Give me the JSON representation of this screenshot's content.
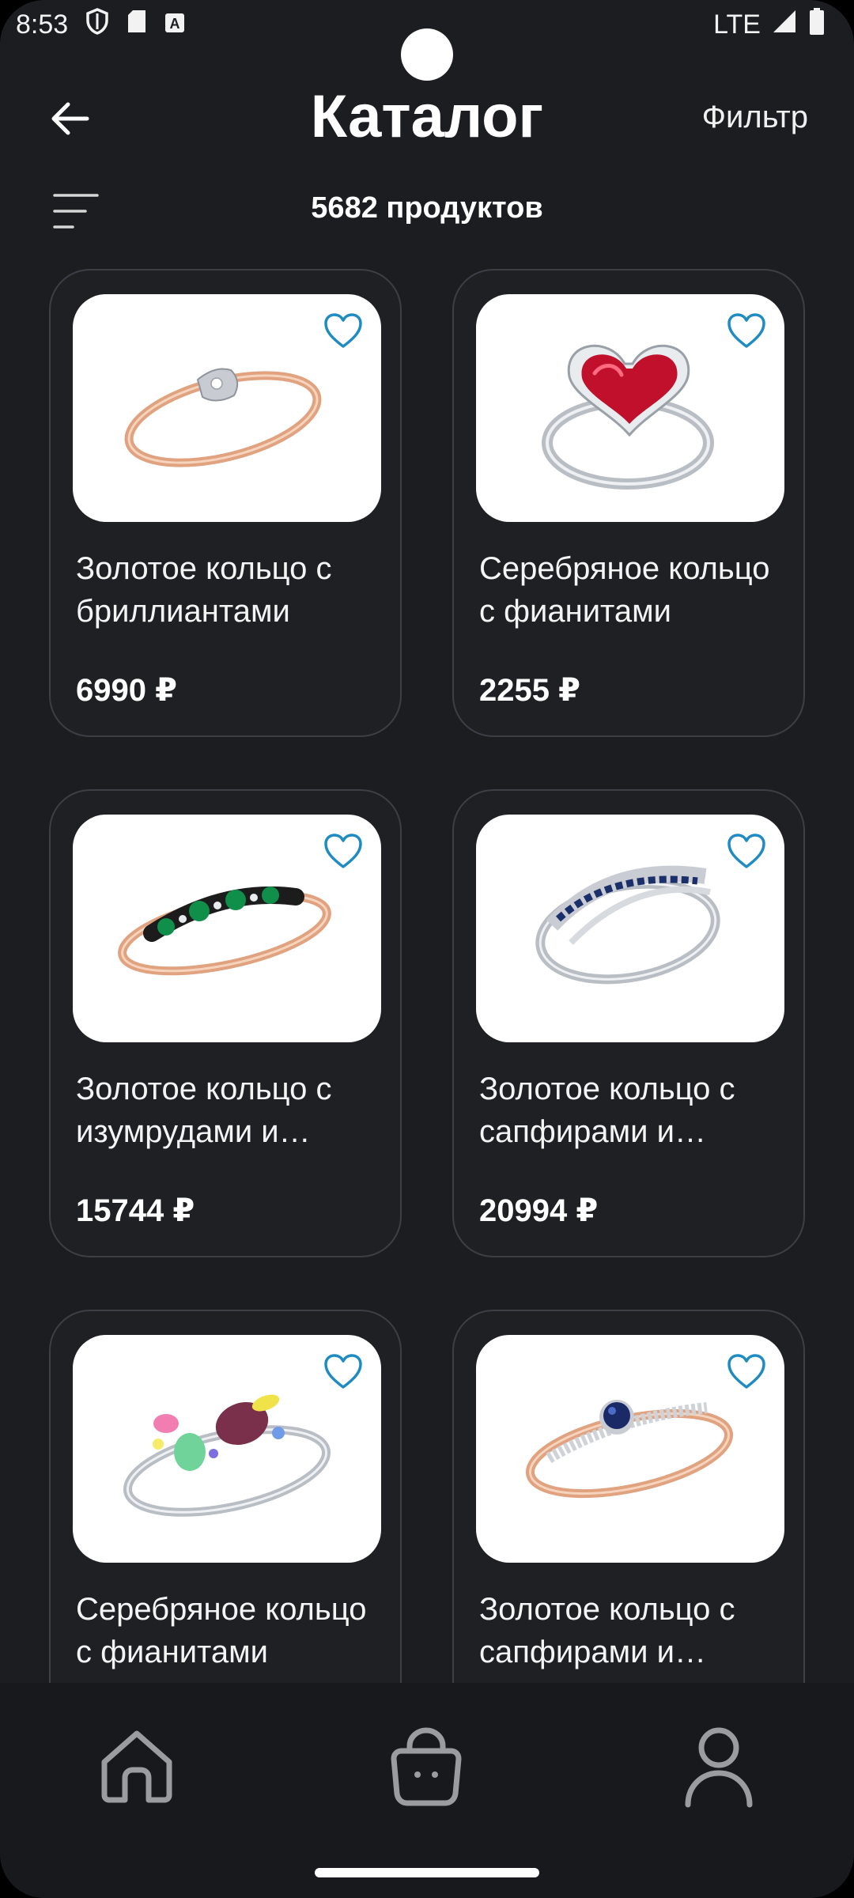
{
  "status_bar": {
    "time": "8:53",
    "network": "LTE",
    "icons": [
      "shield-icon",
      "sd-card-icon",
      "font-icon",
      "signal-icon",
      "battery-icon"
    ]
  },
  "header": {
    "title": "Каталог",
    "filter_label": "Фильтр",
    "product_count": "5682 продуктов"
  },
  "products": [
    {
      "name": "Золотое кольцо с бриллиантами",
      "price": "6990 ₽"
    },
    {
      "name": "Серебряное кольцо с фианитами",
      "price": "2255 ₽"
    },
    {
      "name": "Золотое кольцо с изумрудами и бриллиантами",
      "price": "15744 ₽"
    },
    {
      "name": "Золотое кольцо с сапфирами и бриллиантами",
      "price": "20994 ₽"
    },
    {
      "name": "Серебряное кольцо с фианитами",
      "price": ""
    },
    {
      "name": "Золотое кольцо с сапфирами и бриллиантами",
      "price": ""
    }
  ],
  "bottom_nav": {
    "items": [
      "home-icon",
      "bag-icon",
      "profile-icon"
    ]
  },
  "colors": {
    "background": "#1b1d21",
    "card_border": "#3c3f45",
    "favorite_accent": "#1e8bc3",
    "nav_icon": "#9a9ca0"
  }
}
